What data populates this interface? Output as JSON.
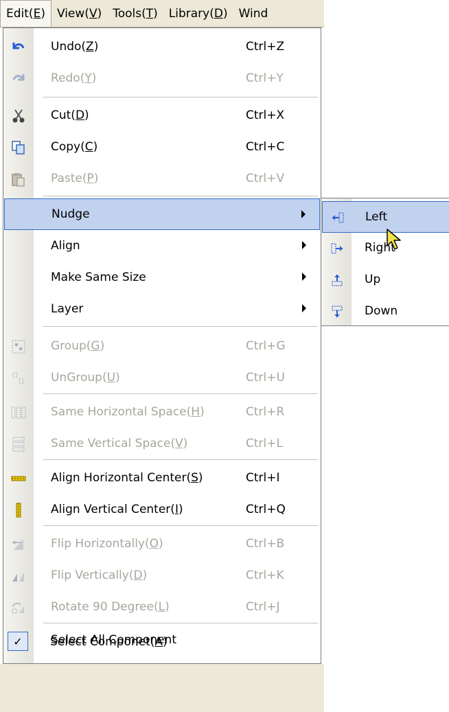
{
  "menubar": [
    {
      "pre": "Edit(",
      "key": "E",
      "post": ")"
    },
    {
      "pre": "View(",
      "key": "V",
      "post": ")"
    },
    {
      "pre": "Tools(",
      "key": "T",
      "post": ")"
    },
    {
      "pre": "Library(",
      "key": "D",
      "post": ")"
    },
    {
      "pre": "Wind",
      "key": "",
      "post": ""
    }
  ],
  "menu": {
    "undo": {
      "pre": "Undo(",
      "key": "Z",
      "post": ")",
      "shortcut": "Ctrl+Z"
    },
    "redo": {
      "pre": "Redo(",
      "key": "Y",
      "post": ")",
      "shortcut": "Ctrl+Y"
    },
    "cut": {
      "pre": "Cut(",
      "key": "D",
      "post": ")",
      "shortcut": "Ctrl+X"
    },
    "copy": {
      "pre": "Copy(",
      "key": "C",
      "post": ")",
      "shortcut": "Ctrl+C"
    },
    "paste": {
      "pre": "Paste(",
      "key": "P",
      "post": ")",
      "shortcut": "Ctrl+V"
    },
    "nudge": "Nudge",
    "align": "Align",
    "same_size": "Make Same Size",
    "layer": "Layer",
    "group": {
      "pre": "Group(",
      "key": "G",
      "post": ")",
      "shortcut": "Ctrl+G"
    },
    "ungroup": {
      "pre": "UnGroup(",
      "key": "U",
      "post": ")",
      "shortcut": "Ctrl+U"
    },
    "h_space": {
      "pre": "Same Horizontal Space(",
      "key": "H",
      "post": ")",
      "shortcut": "Ctrl+R"
    },
    "v_space": {
      "pre": "Same Vertical Space(",
      "key": "V",
      "post": ")",
      "shortcut": "Ctrl+L"
    },
    "h_center": {
      "pre": "Align Horizontal Center(",
      "key": "S",
      "post": ")",
      "shortcut": "Ctrl+I"
    },
    "v_center": {
      "pre": "Align Vertical Center(",
      "key": "I",
      "post": ")",
      "shortcut": "Ctrl+Q"
    },
    "flip_h": {
      "pre": "Flip Horizontally(",
      "key": "O",
      "post": ")",
      "shortcut": "Ctrl+B"
    },
    "flip_v": {
      "pre": "Flip Vertically(",
      "key": "D",
      "post": ")",
      "shortcut": "Ctrl+K"
    },
    "rotate": {
      "pre": "Rotate 90 Degree(",
      "key": "L",
      "post": ")",
      "shortcut": "Ctrl+J"
    },
    "select_all": "Select All Component",
    "select_comp": {
      "pre": "Select Componet(",
      "key": "A",
      "post": ")"
    }
  },
  "submenu": {
    "left": "Left",
    "right": "Right",
    "up": "Up",
    "down": "Down"
  },
  "colors": {
    "highlight": "#c1d2ee",
    "highlight_border": "#316ac5",
    "disabled_text": "#a7a69e",
    "menubar_bg": "#ece9d8"
  }
}
